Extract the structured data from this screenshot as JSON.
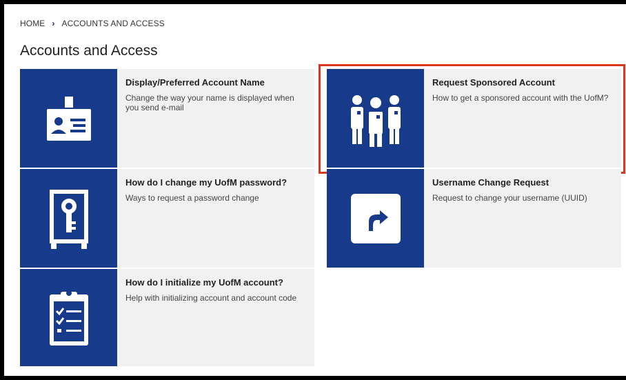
{
  "breadcrumb": {
    "home": "HOME",
    "separator": "›",
    "current": "ACCOUNTS AND ACCESS"
  },
  "page": {
    "title": "Accounts and Access"
  },
  "tiles": [
    {
      "title": "Display/Preferred Account Name",
      "description": "Change the way your name is displayed when you send e-mail",
      "icon": "id-badge-icon"
    },
    {
      "title": "Request Sponsored Account",
      "description": "How to get a sponsored account with the UofM?",
      "icon": "people-group-icon"
    },
    {
      "title": "How do I change my UofM password?",
      "description": "Ways to request a password change",
      "icon": "key-safe-icon"
    },
    {
      "title": "Username Change Request",
      "description": "Request to change your username (UUID)",
      "icon": "redirect-arrow-icon"
    },
    {
      "title": "How do I initialize my UofM account?",
      "description": "Help with initializing account and account code",
      "icon": "clipboard-checklist-icon"
    }
  ],
  "colors": {
    "tile_icon_bg": "#173a8a",
    "tile_bg": "#f1f1f1",
    "highlight_border": "#d9381e"
  }
}
